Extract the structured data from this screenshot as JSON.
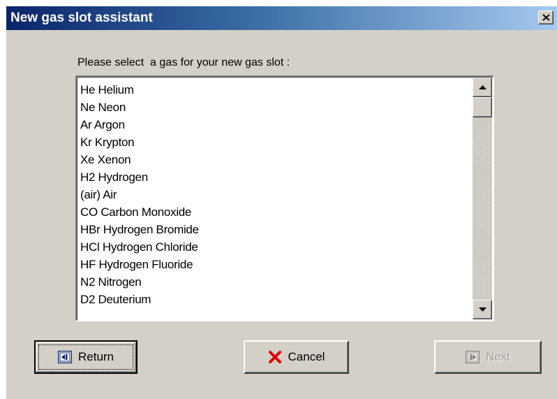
{
  "window": {
    "title": "New gas slot assistant"
  },
  "prompt": "Please select  a gas for your new gas slot :",
  "gas_list": {
    "items": [
      "He Helium",
      "Ne Neon",
      "Ar Argon",
      "Kr Krypton",
      "Xe Xenon",
      "H2 Hydrogen",
      "(air) Air",
      "CO Carbon Monoxide",
      "HBr Hydrogen Bromide",
      "HCl Hydrogen Chloride",
      "HF Hydrogen Fluoride",
      "N2 Nitrogen",
      "D2 Deuterium"
    ]
  },
  "buttons": {
    "return_label": "Return",
    "cancel_label": "Cancel",
    "next_label": "Next"
  },
  "icons": {
    "close": "close-icon",
    "scroll_up": "arrow-up-icon",
    "scroll_down": "arrow-down-icon",
    "return": "back-arrow-icon",
    "cancel": "red-x-icon",
    "next": "forward-arrow-icon"
  },
  "colors": {
    "title_gradient_start": "#0a246a",
    "title_gradient_end": "#a6caf0",
    "dialog_face": "#d4d0c8",
    "cancel_icon": "#e00000",
    "return_icon": "#0a246a"
  }
}
